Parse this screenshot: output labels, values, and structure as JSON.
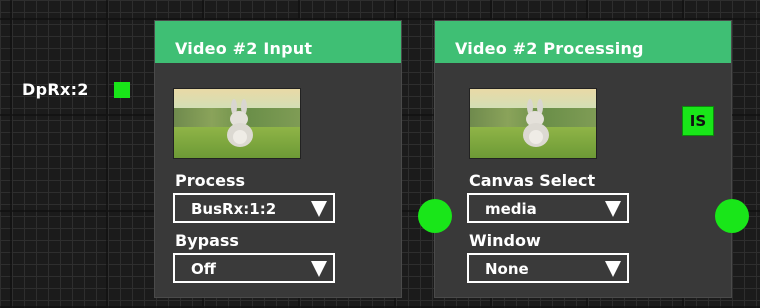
{
  "source_port": {
    "label": "DpRx:2"
  },
  "cards": [
    {
      "title": "Video #2 Input",
      "fields": [
        {
          "label": "Process",
          "value": "BusRx:1:2"
        },
        {
          "label": "Bypass",
          "value": "Off"
        }
      ]
    },
    {
      "title": "Video #2 Processing",
      "badge": "IS",
      "fields": [
        {
          "label": "Canvas Select",
          "value": "media"
        },
        {
          "label": "Window",
          "value": "None"
        }
      ]
    }
  ],
  "colors": {
    "header_green": "#3fbf74",
    "port_green": "#19e619",
    "card_bg": "#393939",
    "canvas_bg": "#1b1b1b"
  },
  "icons": {
    "thumbnail": "video-thumbnail-icon",
    "dropdown": "triangle-down-icon",
    "connector": "circle-port-icon"
  }
}
